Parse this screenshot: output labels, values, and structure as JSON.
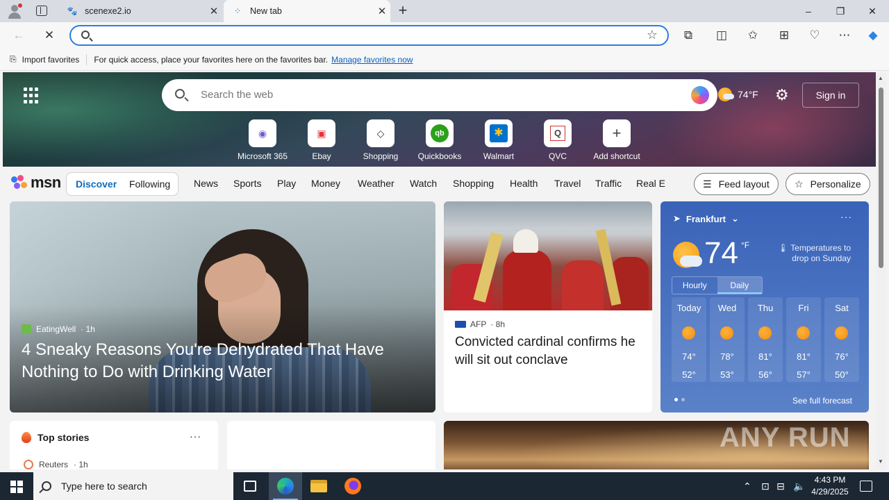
{
  "browser": {
    "tabs": [
      {
        "title": "scenexe2.io",
        "favicon": "paw-icon"
      },
      {
        "title": "New tab",
        "favicon": "loading-icon"
      }
    ],
    "window_controls": {
      "minimize": "–",
      "restore": "❐",
      "close": "✕"
    },
    "address_placeholder": ""
  },
  "favorites_bar": {
    "import_label": "Import favorites",
    "message": "For quick access, place your favorites here on the favorites bar.",
    "manage_link": "Manage favorites now"
  },
  "hero": {
    "search_placeholder": "Search the web",
    "weather_temp": "74°F",
    "sign_in": "Sign in",
    "shortcuts": [
      {
        "label": "Microsoft 365",
        "glyph": "◉",
        "color": "#6b5bd6"
      },
      {
        "label": "Ebay",
        "glyph": "▣",
        "color": "#e53238"
      },
      {
        "label": "Shopping",
        "glyph": "◇",
        "color": "#333333"
      },
      {
        "label": "Quickbooks",
        "glyph": "qb",
        "color": "#2ca01c"
      },
      {
        "label": "Walmart",
        "glyph": "✱",
        "color": "#ffc220"
      },
      {
        "label": "QVC",
        "glyph": "Q",
        "color": "#444444"
      },
      {
        "label": "Add shortcut",
        "glyph": "+",
        "color": "#444444"
      }
    ]
  },
  "msn": {
    "logo": "msn",
    "discover": "Discover",
    "following": "Following",
    "nav": [
      "News",
      "Sports",
      "Play",
      "Money",
      "Weather",
      "Watch",
      "Shopping",
      "Health",
      "Travel",
      "Traffic",
      "Real E"
    ],
    "feed_layout": "Feed layout",
    "personalize": "Personalize"
  },
  "feature_story": {
    "source": "EatingWell",
    "age": "· 1h",
    "headline": "4 Sneaky Reasons You're Dehydrated That Have Nothing to Do with Drinking Water"
  },
  "afp_story": {
    "source": "AFP",
    "age": "· 8h",
    "headline": "Convicted cardinal confirms he will sit out conclave"
  },
  "weather": {
    "location": "Frankfurt",
    "temp": "74",
    "unit": "°F",
    "alert": "Temperatures to drop on Sunday",
    "tab_hourly": "Hourly",
    "tab_daily": "Daily",
    "days": [
      {
        "name": "Today",
        "hi": "74°",
        "lo": "52°"
      },
      {
        "name": "Wed",
        "hi": "78°",
        "lo": "53°"
      },
      {
        "name": "Thu",
        "hi": "81°",
        "lo": "56°"
      },
      {
        "name": "Fri",
        "hi": "81°",
        "lo": "57°"
      },
      {
        "name": "Sat",
        "hi": "76°",
        "lo": "50°"
      }
    ],
    "full_forecast": "See full forecast"
  },
  "top_stories": {
    "title": "Top stories",
    "first_source": "Reuters",
    "first_age": "· 1h"
  },
  "watermark": "ANY RUN",
  "taskbar": {
    "search_placeholder": "Type here to search",
    "time": "4:43 PM",
    "date": "4/29/2025"
  }
}
